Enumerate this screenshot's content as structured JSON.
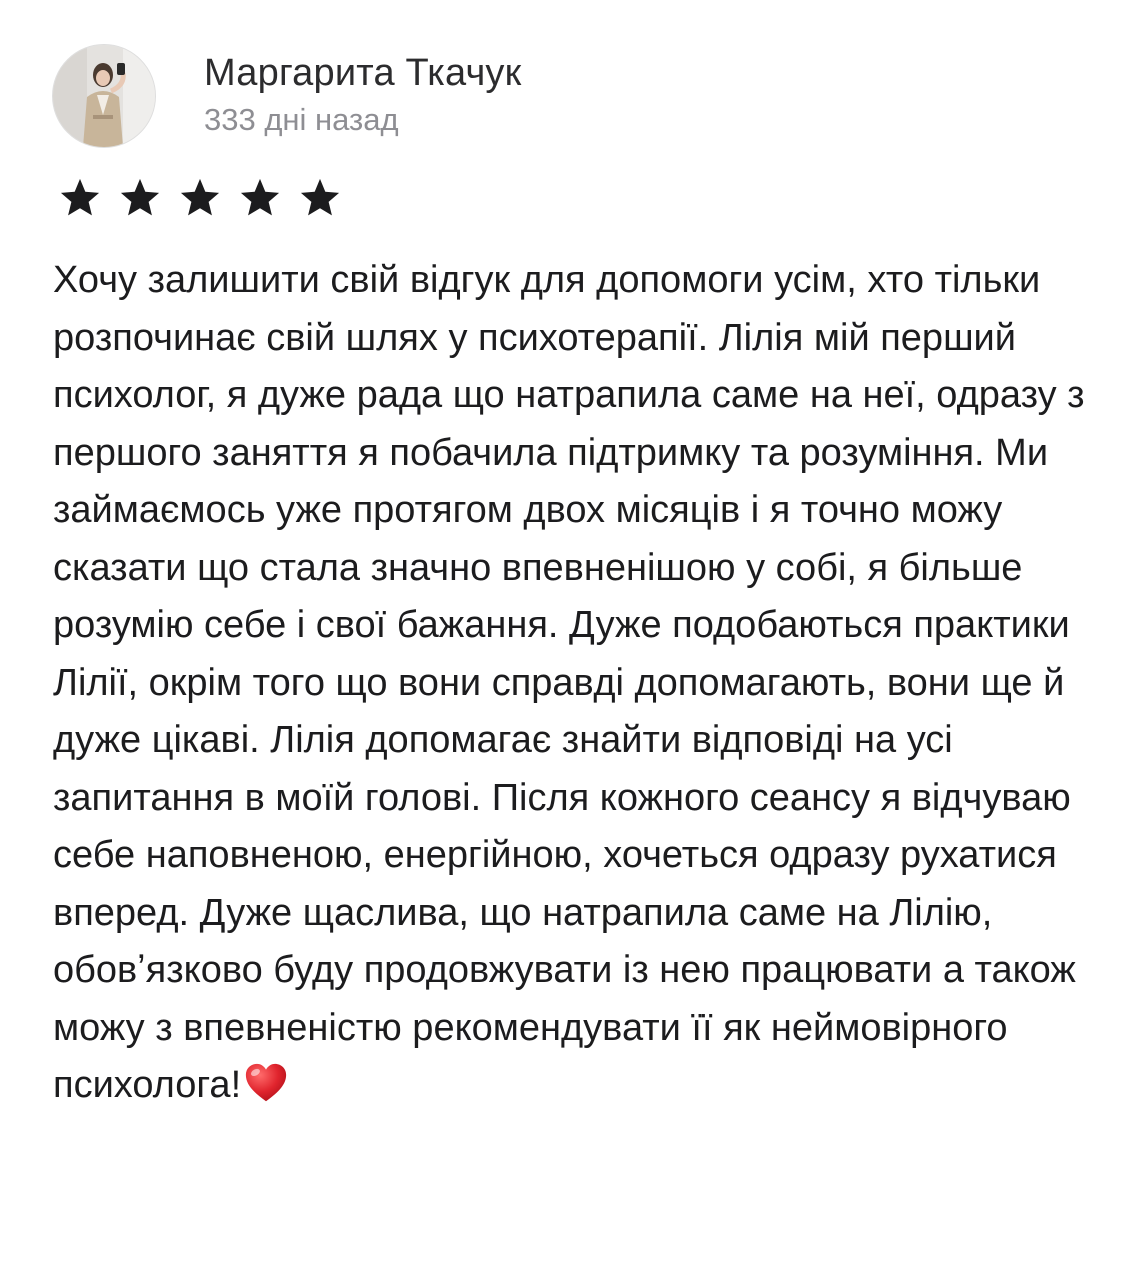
{
  "review": {
    "author_name": "Маргарита Ткачук",
    "date": "333 дні назад",
    "rating": 5,
    "rating_max": 5,
    "star_color": "#1c1c1e",
    "text": "Хочу залишити свій відгук для допомоги усім, хто тільки розпочинає свій шлях у психотерапії. Лілія мій перший психолог, я дуже рада що натрапила саме на неї, одразу з першого заняття я побачила підтримку та розуміння. Ми займаємось уже протягом двох місяців і я точно можу сказати що стала значно впевненішою у собі, я більше розумію себе і свої бажання. Дуже подобаються практики Лілії, окрім того що вони справді допомагають, вони ще й дуже цікаві. Лілія допомагає знайти відповіді на усі запитання в моїй голові. Після кожного сеансу я відчуваю себе наповненою, енергійною, хочеться одразу рухатися вперед. Дуже щаслива, що натрапила саме на Лілію, обовʼязково буду продовжувати із нею працювати а також можу з впевненістю рекомендувати її як неймовірного психолога!",
    "trailing_icon": "red-heart-icon",
    "heart_color": "#e0242d"
  }
}
